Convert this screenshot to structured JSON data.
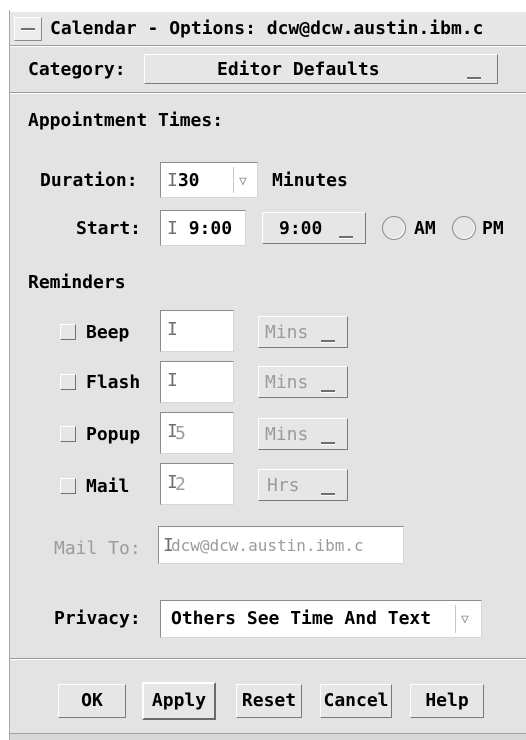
{
  "window": {
    "title": "Calendar - Options: dcw@dcw.austin.ibm.c"
  },
  "category": {
    "label": "Category:",
    "value": "Editor Defaults"
  },
  "appointment": {
    "section_label": "Appointment Times:",
    "duration_label": "Duration:",
    "duration_value": "30",
    "duration_unit": "Minutes",
    "start_label": "Start:",
    "start_value": "9:00",
    "start_menu": "9:00",
    "am_label": "AM",
    "pm_label": "PM"
  },
  "reminders": {
    "section_label": "Reminders",
    "items": [
      {
        "label": "Beep",
        "value": "",
        "unit": "Mins"
      },
      {
        "label": "Flash",
        "value": "",
        "unit": "Mins"
      },
      {
        "label": "Popup",
        "value": "5",
        "unit": "Mins"
      },
      {
        "label": "Mail",
        "value": "2",
        "unit": "Hrs"
      }
    ],
    "mail_to_label": "Mail To:",
    "mail_to_value": "dcw@dcw.austin.ibm.c"
  },
  "privacy": {
    "label": "Privacy:",
    "value": "Others See Time And Text"
  },
  "buttons": {
    "ok": "OK",
    "apply": "Apply",
    "reset": "Reset",
    "cancel": "Cancel",
    "help": "Help"
  },
  "icons": {
    "window_menu": "window-menu-icon",
    "dropdown": "dropdown-triangle-icon",
    "option_menu": "option-menu-dash-icon"
  }
}
